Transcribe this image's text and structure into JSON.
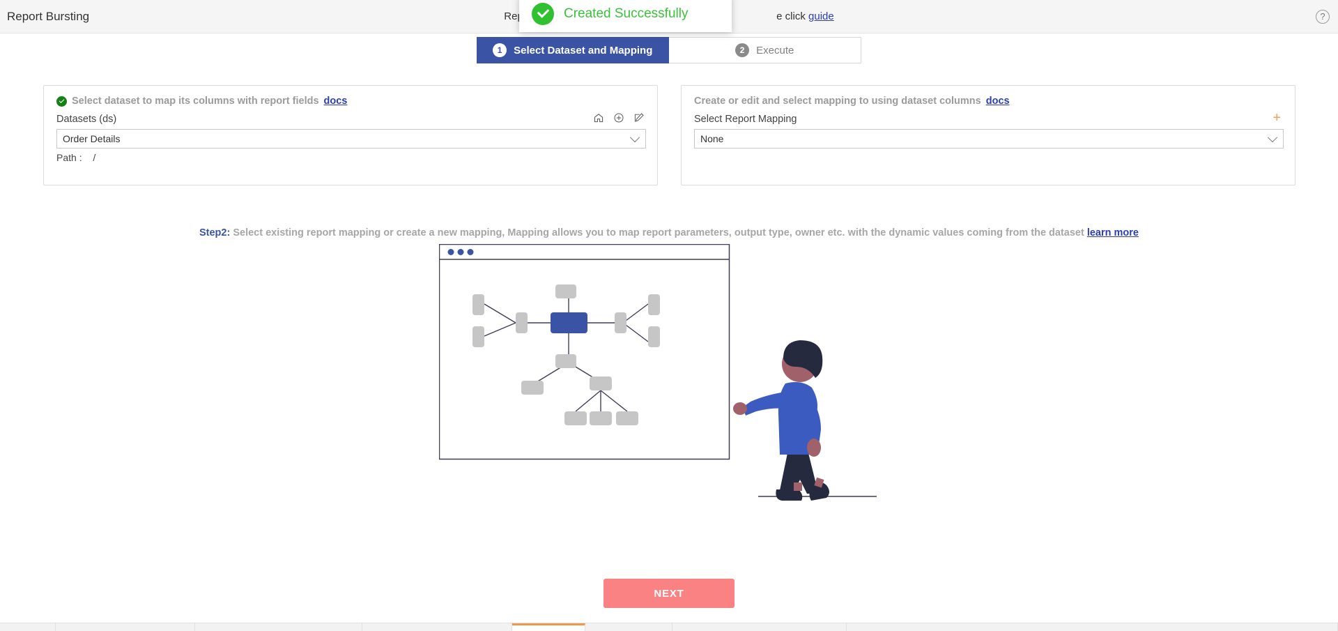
{
  "header": {
    "title": "Report Bursting",
    "center_text_before": "Report burst",
    "center_text_after": "e click ",
    "guide_link": "guide",
    "help_icon": "question-mark-icon"
  },
  "toast": {
    "icon": "check-circle-icon",
    "message": "Created Successfully",
    "color": "#3ac13a"
  },
  "stepper": {
    "steps": [
      {
        "number": "1",
        "label": "Select Dataset and Mapping",
        "active": true
      },
      {
        "number": "2",
        "label": "Execute",
        "active": false
      }
    ],
    "active_color": "#3a53a4"
  },
  "left_panel": {
    "heading": "Select dataset to map its columns with report fields",
    "docs_label": "docs",
    "field_label": "Datasets (ds)",
    "selected_value": "Order Details",
    "path_label": "Path :",
    "path_value": "/",
    "icons": [
      "home-icon",
      "plus-circle-icon",
      "edit-pencil-icon"
    ]
  },
  "right_panel": {
    "heading": "Create or edit and select mapping to using dataset columns",
    "docs_label": "docs",
    "field_label": "Select Report Mapping",
    "selected_value": "None",
    "add_icon": "plus-icon",
    "add_icon_color": "#f3a05a"
  },
  "step2": {
    "key": "Step2:",
    "text": " Select existing report mapping or create a new mapping, Mapping allows you to map report parameters, output type, owner etc. with the dynamic values coming from the dataset ",
    "learn_more": "learn more"
  },
  "illustration": {
    "name": "mapping-diagram-illustration",
    "node_color": "#c6c6c6",
    "active_node_color": "#3a53a4",
    "person_shirt_color": "#3b5bc0",
    "person_pants_color": "#262a3f",
    "person_skin_color": "#a0616a"
  },
  "next_button": {
    "label": "NEXT",
    "color": "#fa8282"
  },
  "footer": {
    "accent_color": "#f0974a"
  }
}
